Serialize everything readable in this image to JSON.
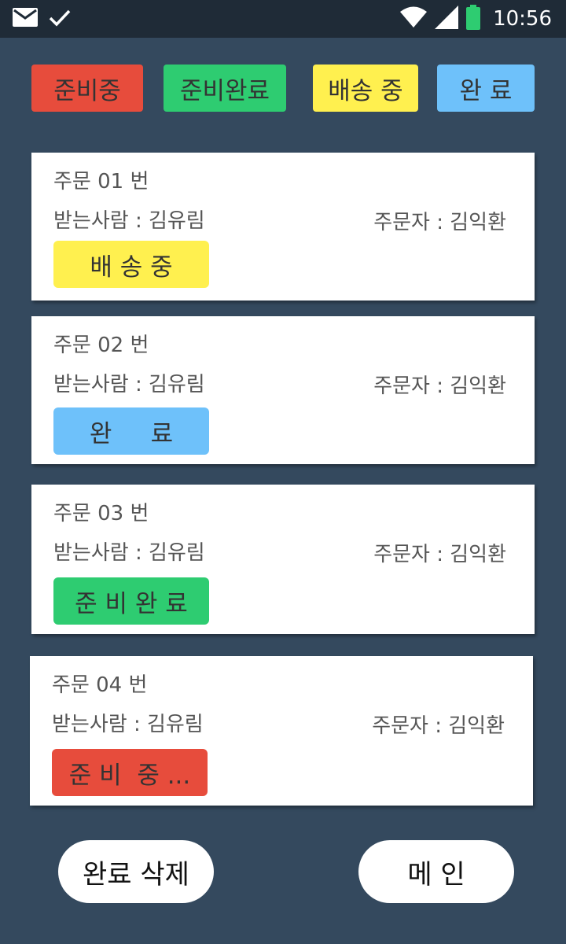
{
  "status_bar": {
    "time": "10:56",
    "icons": [
      "mail-icon",
      "check-icon",
      "wifi-icon",
      "signal-icon",
      "battery-icon"
    ]
  },
  "filters": [
    {
      "label": "준비중",
      "color": "#e74c3c"
    },
    {
      "label": "준비완료",
      "color": "#2ecc71"
    },
    {
      "label": "배송 중",
      "color": "#fff04f"
    },
    {
      "label": "완 료",
      "color": "#6ec1fa"
    }
  ],
  "orders": [
    {
      "title": "주문 01 번",
      "recipient": "받는사람 :  김유림",
      "orderer": "주문자 : 김익환",
      "status": "배 송 중",
      "status_color": "#fff04f"
    },
    {
      "title": "주문 02 번",
      "recipient": "받는사람 :  김유림",
      "orderer": "주문자 : 김익환",
      "status": "완     료",
      "status_color": "#6ec1fa"
    },
    {
      "title": "주문 03 번",
      "recipient": "받는사람 :  김유림",
      "orderer": "주문자 : 김익환",
      "status": "준 비 완 료",
      "status_color": "#2ecc71"
    },
    {
      "title": "주문 04 번",
      "recipient": "받는사람 :  김유림",
      "orderer": "주문자 : 김익환",
      "status": "준 비  중 ...",
      "status_color": "#e74c3c"
    }
  ],
  "actions": {
    "delete_completed": "완료 삭제",
    "main": "메 인"
  }
}
